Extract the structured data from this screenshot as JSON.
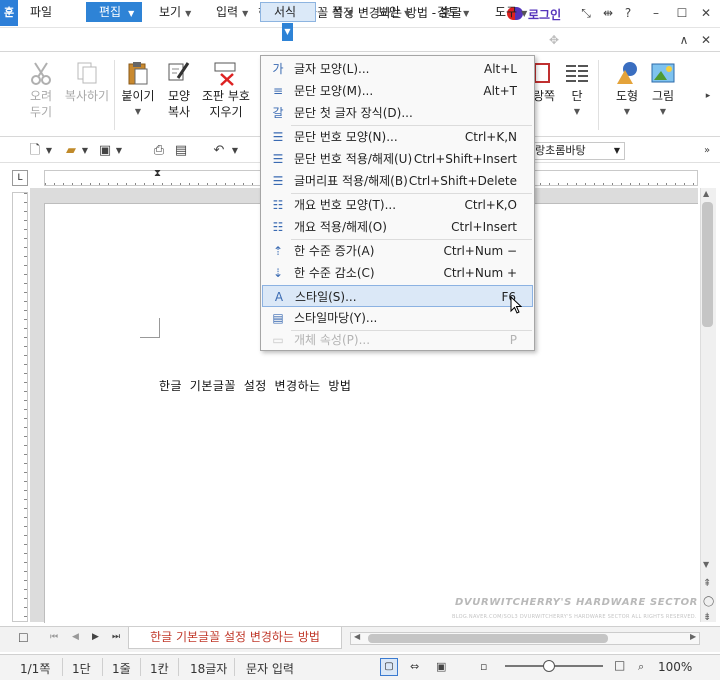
{
  "window": {
    "title": "한글 기본글꼴 설정 변경하는 방법 - 훈글",
    "app_icon": "훈",
    "login": "로그인",
    "controls": [
      "fullscreen-icon",
      "split-icon",
      "help-icon",
      "minimize-icon",
      "restore-icon",
      "close-icon"
    ]
  },
  "menubar": {
    "items": [
      {
        "label": "파일"
      },
      {
        "label": "편집"
      },
      {
        "label": "보기"
      },
      {
        "label": "입력"
      },
      {
        "label": "서식"
      },
      {
        "label": "쪽"
      },
      {
        "label": "보안"
      },
      {
        "label": "검토"
      },
      {
        "label": "도구"
      }
    ]
  },
  "ribbon": {
    "cut": {
      "line1": "오려",
      "line2": "두기"
    },
    "copy": {
      "line1": "복사하기"
    },
    "paste": {
      "line1": "붙이기"
    },
    "format_copy": {
      "line1": "모양",
      "line2": "복사"
    },
    "clear_format": {
      "line1": "조판 부호",
      "line2": "지우기"
    },
    "right_partial": {
      "a": "랑쪽",
      "b": "단",
      "c": "도형",
      "d": "그림"
    }
  },
  "toolbar2": {
    "style_value": "랑초롬바탕"
  },
  "format_menu": {
    "items": [
      {
        "label": "글자 모양(L)...",
        "shortcut": "Alt+L",
        "icon": "char-shape-icon",
        "glyph": "가"
      },
      {
        "label": "문단 모양(M)...",
        "shortcut": "Alt+T",
        "icon": "para-shape-icon",
        "glyph": "≡"
      },
      {
        "label": "문단 첫 글자 장식(D)...",
        "shortcut": "",
        "icon": "drop-cap-icon",
        "glyph": "갈"
      },
      {
        "label": "문단 번호 모양(N)...",
        "shortcut": "Ctrl+K,N",
        "icon": "para-number-icon",
        "glyph": "☰"
      },
      {
        "label": "문단 번호 적용/해제(U)",
        "shortcut": "Ctrl+Shift+Insert",
        "icon": "para-number-toggle-icon",
        "glyph": "☰"
      },
      {
        "label": "글머리표 적용/해제(B)",
        "shortcut": "Ctrl+Shift+Delete",
        "icon": "bullet-toggle-icon",
        "glyph": "☰"
      },
      {
        "label": "개요 번호 모양(T)...",
        "shortcut": "Ctrl+K,O",
        "icon": "outline-number-icon",
        "glyph": "☷"
      },
      {
        "label": "개요 적용/해제(O)",
        "shortcut": "Ctrl+Insert",
        "icon": "outline-toggle-icon",
        "glyph": "☷"
      },
      {
        "label": "한 수준 증가(A)",
        "shortcut": "Ctrl+Num −",
        "icon": "level-up-icon",
        "glyph": "⇡"
      },
      {
        "label": "한 수준 감소(C)",
        "shortcut": "Ctrl+Num +",
        "icon": "level-down-icon",
        "glyph": "⇣"
      },
      {
        "label": "스타일(S)...",
        "shortcut": "F6",
        "icon": "style-icon",
        "glyph": "A"
      },
      {
        "label": "스타일마당(Y)...",
        "shortcut": "",
        "icon": "style-gallery-icon",
        "glyph": "▤"
      },
      {
        "label": "개체 속성(P)...",
        "shortcut": "P",
        "icon": "object-props-icon",
        "glyph": "▭"
      }
    ],
    "highlighted_index": 10,
    "disabled_index": 12
  },
  "document": {
    "body_text": "한글 기본글꼴 설정 변경하는 방법",
    "tab_label": "한글 기본글꼴 설정 변경하는 방법"
  },
  "watermark": {
    "line1": "DVURWITCHERRY'S HARDWARE SECTOR",
    "line2": "BLOG.NAVER.COM/SOL3 DVURWITCHERRY'S HARDWARE SECTOR ALL RIGHTS RESERVED."
  },
  "statusbar": {
    "page": "1/1쪽",
    "column": "1단",
    "line": "1줄",
    "col": "1칸",
    "chars": "18글자",
    "mode": "문자 입력",
    "zoom": "100%",
    "zoom_fraction": 0.45
  },
  "colors": {
    "accent": "#2e83d6",
    "login": "#5533bb",
    "tab_text": "#c0392b",
    "highlight": "#dbe8f7"
  }
}
